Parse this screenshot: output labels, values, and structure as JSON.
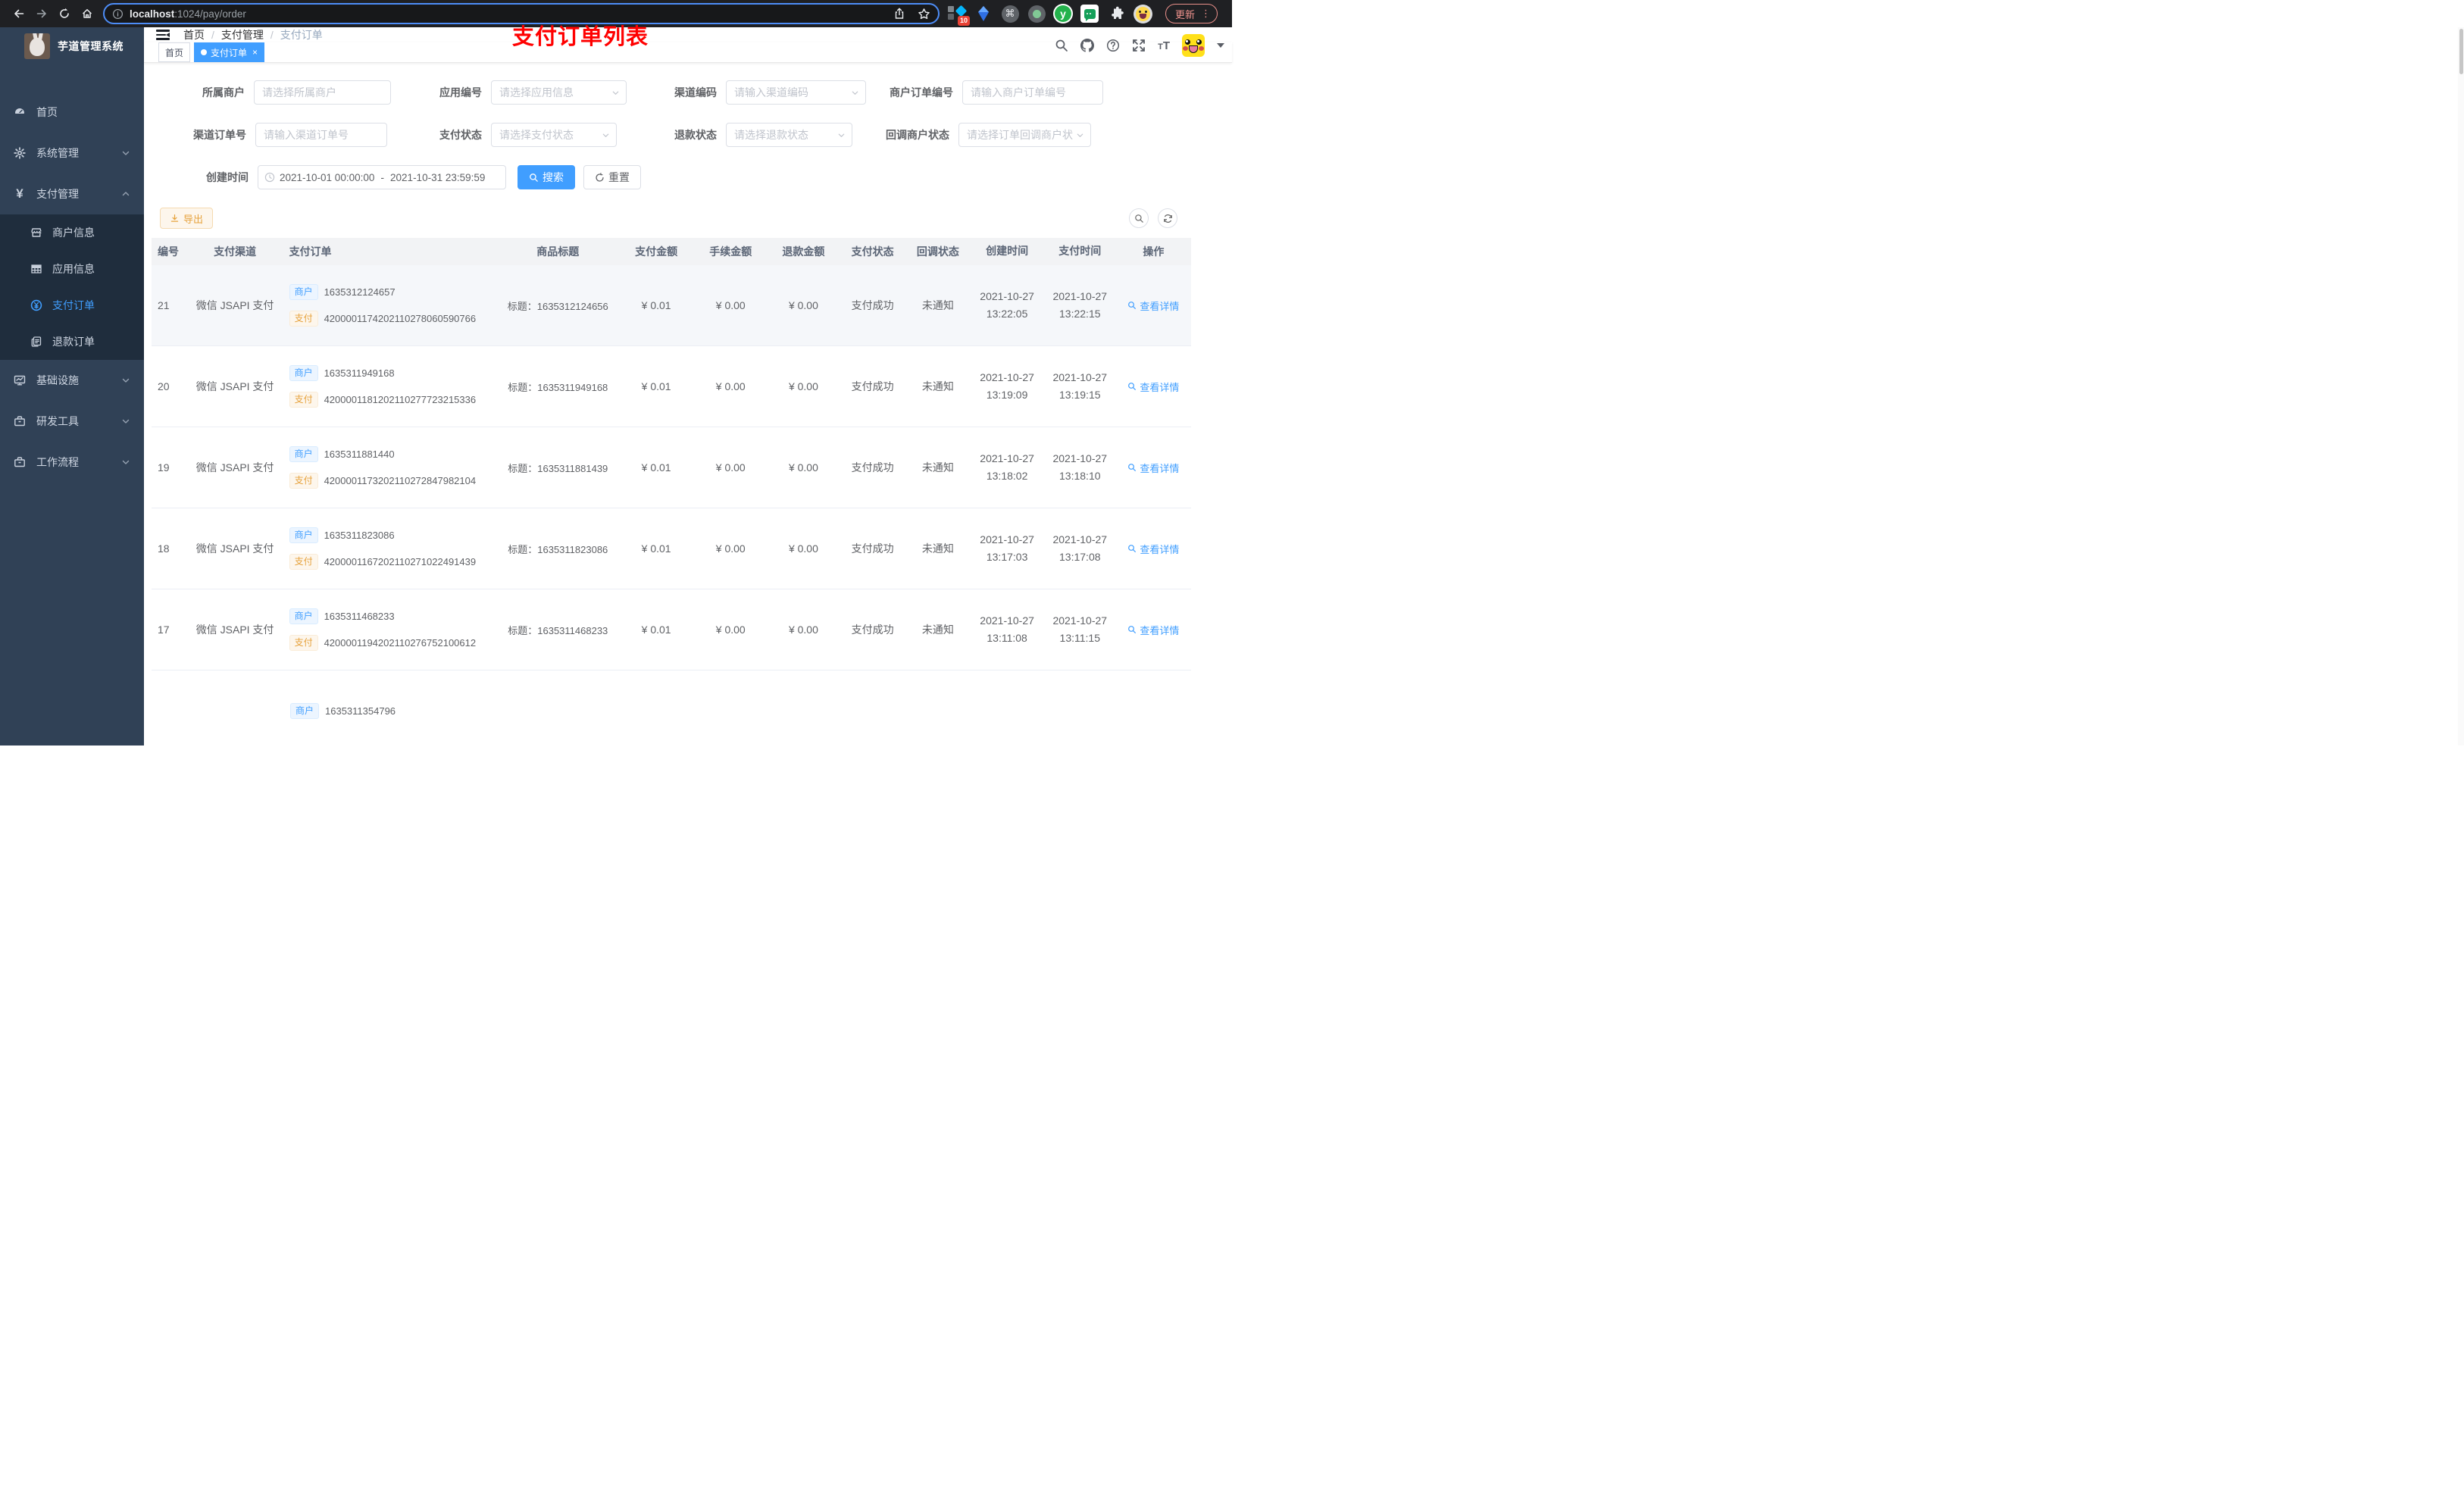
{
  "browser": {
    "url_host": "localhost",
    "url_path": ":1024/pay/order",
    "extension_badge": "10",
    "extension_y_label": "y",
    "update_button": "更新",
    "menu_dots": "⋮"
  },
  "sidebar": {
    "app_title": "芋道管理系统",
    "items": {
      "home": "首页",
      "system": "系统管理",
      "pay": "支付管理",
      "merchant_info": "商户信息",
      "app_info": "应用信息",
      "pay_order": "支付订单",
      "refund_order": "退款订单",
      "infra": "基础设施",
      "dev_tools": "研发工具",
      "workflow": "工作流程"
    }
  },
  "header": {
    "breadcrumb": {
      "0": "首页",
      "1": "支付管理",
      "2": "支付订单"
    },
    "page_title": "支付订单列表",
    "fontsize_icon_text": "tT"
  },
  "tags": {
    "home": "首页",
    "active": "支付订单",
    "close": "×"
  },
  "filters": {
    "merchant": {
      "label": "所属商户",
      "placeholder": "请选择所属商户"
    },
    "app": {
      "label": "应用编号",
      "placeholder": "请选择应用信息"
    },
    "channel_code": {
      "label": "渠道编码",
      "placeholder": "请输入渠道编码"
    },
    "merchant_order_no": {
      "label": "商户订单编号",
      "placeholder": "请输入商户订单编号"
    },
    "channel_order_no": {
      "label": "渠道订单号",
      "placeholder": "请输入渠道订单号"
    },
    "pay_status": {
      "label": "支付状态",
      "placeholder": "请选择支付状态"
    },
    "refund_status": {
      "label": "退款状态",
      "placeholder": "请选择退款状态"
    },
    "notify_status": {
      "label": "回调商户状态",
      "placeholder": "请选择订单回调商户状态"
    },
    "create_time": {
      "label": "创建时间",
      "start": "2021-10-01 00:00:00",
      "separator": "-",
      "end": "2021-10-31 23:59:59"
    },
    "search_button": "搜索",
    "reset_button": "重置"
  },
  "toolbar": {
    "export_button": "导出"
  },
  "table": {
    "headers": {
      "0": "编号",
      "1": "支付渠道",
      "2": "支付订单",
      "3": "商品标题",
      "4": "支付金额",
      "5": "手续金额",
      "6": "退款金额",
      "7": "支付状态",
      "8": "回调状态",
      "9": "创建时间",
      "10": "支付时间",
      "11": "操作"
    },
    "merchant_tag": "商户",
    "pay_tag": "支付",
    "view_detail": "查看详情",
    "rows": {
      "0": {
        "id": "21",
        "channel": "微信 JSAPI 支付",
        "merchant_no": "1635312124657",
        "pay_no": "4200001174202110278060590766",
        "title": "标题：1635312124656",
        "amount": "¥ 0.01",
        "fee": "¥ 0.00",
        "refund": "¥ 0.00",
        "status": "支付成功",
        "notify": "未通知",
        "create_date": "2021-10-27",
        "create_time": "13:22:05",
        "pay_date": "2021-10-27",
        "pay_time": "13:22:15"
      },
      "1": {
        "id": "20",
        "channel": "微信 JSAPI 支付",
        "merchant_no": "1635311949168",
        "pay_no": "4200001181202110277723215336",
        "title": "标题：1635311949168",
        "amount": "¥ 0.01",
        "fee": "¥ 0.00",
        "refund": "¥ 0.00",
        "status": "支付成功",
        "notify": "未通知",
        "create_date": "2021-10-27",
        "create_time": "13:19:09",
        "pay_date": "2021-10-27",
        "pay_time": "13:19:15"
      },
      "2": {
        "id": "19",
        "channel": "微信 JSAPI 支付",
        "merchant_no": "1635311881440",
        "pay_no": "4200001173202110272847982104",
        "title": "标题：1635311881439",
        "amount": "¥ 0.01",
        "fee": "¥ 0.00",
        "refund": "¥ 0.00",
        "status": "支付成功",
        "notify": "未通知",
        "create_date": "2021-10-27",
        "create_time": "13:18:02",
        "pay_date": "2021-10-27",
        "pay_time": "13:18:10"
      },
      "3": {
        "id": "18",
        "channel": "微信 JSAPI 支付",
        "merchant_no": "1635311823086",
        "pay_no": "4200001167202110271022491439",
        "title": "标题：1635311823086",
        "amount": "¥ 0.01",
        "fee": "¥ 0.00",
        "refund": "¥ 0.00",
        "status": "支付成功",
        "notify": "未通知",
        "create_date": "2021-10-27",
        "create_time": "13:17:03",
        "pay_date": "2021-10-27",
        "pay_time": "13:17:08"
      },
      "4": {
        "id": "17",
        "channel": "微信 JSAPI 支付",
        "merchant_no": "1635311468233",
        "pay_no": "4200001194202110276752100612",
        "title": "标题：1635311468233",
        "amount": "¥ 0.01",
        "fee": "¥ 0.00",
        "refund": "¥ 0.00",
        "status": "支付成功",
        "notify": "未通知",
        "create_date": "2021-10-27",
        "create_time": "13:11:08",
        "pay_date": "2021-10-27",
        "pay_time": "13:11:15"
      },
      "5": {
        "merchant_no": "1635311354796"
      }
    }
  }
}
